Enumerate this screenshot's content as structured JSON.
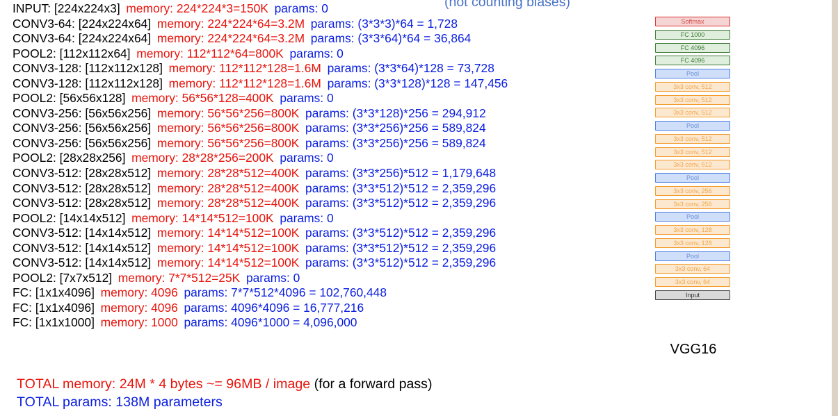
{
  "note": "(not counting biases)",
  "layers": [
    {
      "name": "INPUT: [224x224x3]",
      "memory": "memory:  224*224*3=150K",
      "params": "params: 0"
    },
    {
      "name": "CONV3-64: [224x224x64]",
      "memory": "memory:  224*224*64=3.2M",
      "params": "params: (3*3*3)*64 = 1,728"
    },
    {
      "name": "CONV3-64: [224x224x64]",
      "memory": "memory:  224*224*64=3.2M",
      "params": "params: (3*3*64)*64 = 36,864"
    },
    {
      "name": "POOL2: [112x112x64]",
      "memory": "memory:  112*112*64=800K",
      "params": "params: 0"
    },
    {
      "name": "CONV3-128: [112x112x128]",
      "memory": "memory:  112*112*128=1.6M",
      "params": "params: (3*3*64)*128 = 73,728"
    },
    {
      "name": "CONV3-128: [112x112x128]",
      "memory": "memory:  112*112*128=1.6M",
      "params": "params: (3*3*128)*128 = 147,456"
    },
    {
      "name": "POOL2: [56x56x128]",
      "memory": "memory:  56*56*128=400K",
      "params": "params: 0"
    },
    {
      "name": "CONV3-256: [56x56x256]",
      "memory": "memory:  56*56*256=800K",
      "params": "params: (3*3*128)*256 = 294,912"
    },
    {
      "name": "CONV3-256: [56x56x256]",
      "memory": "memory:  56*56*256=800K",
      "params": "params: (3*3*256)*256 = 589,824"
    },
    {
      "name": "CONV3-256: [56x56x256]",
      "memory": "memory:  56*56*256=800K",
      "params": "params: (3*3*256)*256 = 589,824"
    },
    {
      "name": "POOL2: [28x28x256]",
      "memory": "memory:  28*28*256=200K",
      "params": "params: 0"
    },
    {
      "name": "CONV3-512: [28x28x512]",
      "memory": "memory:  28*28*512=400K",
      "params": "params: (3*3*256)*512 = 1,179,648"
    },
    {
      "name": "CONV3-512: [28x28x512]",
      "memory": "memory:  28*28*512=400K",
      "params": "params: (3*3*512)*512 = 2,359,296"
    },
    {
      "name": "CONV3-512: [28x28x512]",
      "memory": "memory:  28*28*512=400K",
      "params": "params: (3*3*512)*512 = 2,359,296"
    },
    {
      "name": "POOL2: [14x14x512]",
      "memory": "memory:  14*14*512=100K",
      "params": "params: 0"
    },
    {
      "name": "CONV3-512: [14x14x512]",
      "memory": "memory:  14*14*512=100K",
      "params": "params: (3*3*512)*512 = 2,359,296"
    },
    {
      "name": "CONV3-512: [14x14x512]",
      "memory": "memory:  14*14*512=100K",
      "params": "params: (3*3*512)*512 = 2,359,296"
    },
    {
      "name": "CONV3-512: [14x14x512]",
      "memory": "memory:  14*14*512=100K",
      "params": "params: (3*3*512)*512 = 2,359,296"
    },
    {
      "name": "POOL2: [7x7x512]",
      "memory": "memory:  7*7*512=25K",
      "params": "params: 0"
    },
    {
      "name": "FC: [1x1x4096]",
      "memory": "memory:  4096",
      "params": "params: 7*7*512*4096 = 102,760,448"
    },
    {
      "name": "FC: [1x1x4096]",
      "memory": "memory:  4096",
      "params": "params: 4096*4096 = 16,777,216"
    },
    {
      "name": "FC: [1x1x1000]",
      "memory": "memory:  1000",
      "params": "params: 4096*1000 = 4,096,000"
    }
  ],
  "totals": {
    "memory": "TOTAL memory: 24M * 4 bytes ~= 96MB / image",
    "memory_suffix": "(for a forward pass)",
    "params": "TOTAL params: 138M parameters"
  },
  "diagram": {
    "caption": "VGG16",
    "blocks": [
      {
        "label": "Softmax",
        "kind": "softmax"
      },
      {
        "label": "FC 1000",
        "kind": "fc"
      },
      {
        "label": "FC 4096",
        "kind": "fc"
      },
      {
        "label": "FC 4096",
        "kind": "fc"
      },
      {
        "label": "Pool",
        "kind": "pool"
      },
      {
        "label": "3x3 conv, 512",
        "kind": "conv"
      },
      {
        "label": "3x3 conv, 512",
        "kind": "conv"
      },
      {
        "label": "3x3 conv, 512",
        "kind": "conv"
      },
      {
        "label": "Pool",
        "kind": "pool"
      },
      {
        "label": "3x3 conv, 512",
        "kind": "conv"
      },
      {
        "label": "3x3 conv, 512",
        "kind": "conv"
      },
      {
        "label": "3x3 conv, 512",
        "kind": "conv"
      },
      {
        "label": "Pool",
        "kind": "pool"
      },
      {
        "label": "3x3 conv, 256",
        "kind": "conv"
      },
      {
        "label": "3x3 conv, 256",
        "kind": "conv"
      },
      {
        "label": "Pool",
        "kind": "pool"
      },
      {
        "label": "3x3 conv, 128",
        "kind": "conv"
      },
      {
        "label": "3x3 conv, 128",
        "kind": "conv"
      },
      {
        "label": "Pool",
        "kind": "pool"
      },
      {
        "label": "3x3 conv, 64",
        "kind": "conv"
      },
      {
        "label": "3x3 conv, 64",
        "kind": "conv"
      },
      {
        "label": "Input",
        "kind": "input"
      }
    ]
  },
  "colors": {
    "memory_text": "#e8140c",
    "params_text": "#0a1ee0",
    "note_text": "#4a72c8",
    "softmax": "#dd3333",
    "fc": "#3f7a37",
    "pool": "#4d7fe0",
    "conv": "#f39c2c",
    "input": "#444444"
  }
}
